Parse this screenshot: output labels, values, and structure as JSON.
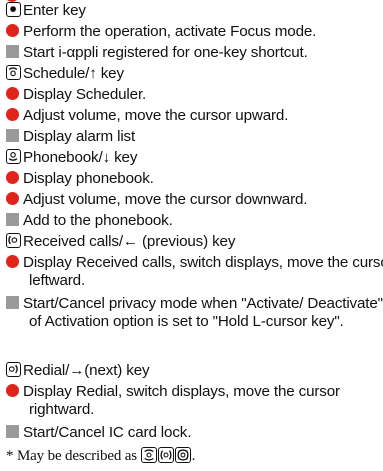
{
  "colors": {
    "bullet": "#e0241b",
    "square": "#9a9a9a"
  },
  "lines": [
    {
      "key_icon": "enter-key-icon",
      "text": "Enter key"
    },
    {
      "text": "Perform the operation, activate Focus mode."
    },
    {
      "text": "Start i-αppli registered for one-key shortcut."
    },
    {
      "key_icon": "schedule-up-key-icon",
      "text": "Schedule/↑ key"
    },
    {
      "text": "Display Scheduler."
    },
    {
      "text": "Adjust volume, move the cursor upward."
    },
    {
      "text": "Display alarm list"
    },
    {
      "key_icon": "phonebook-down-key-icon",
      "text": "Phonebook/↓ key"
    },
    {
      "text": "Display phonebook."
    },
    {
      "text": "Adjust volume, move the cursor downward."
    },
    {
      "text": "Add to the phonebook."
    },
    {
      "key_icon": "received-calls-left-key-icon",
      "text": "Received calls/← (previous) key"
    },
    {
      "text": "Display Received calls, switch displays, move the cursor leftward."
    },
    {
      "text": "Start/Cancel privacy mode when \"Activate/ Deactivate\" of Activation option is set to \"Hold L-cursor key\"."
    },
    {
      "key_icon": "redial-right-key-icon",
      "text": "Redial/→(next) key"
    },
    {
      "text": "Display Redial, switch displays, move the cursor rightward."
    },
    {
      "text": "Start/Cancel IC card lock."
    },
    {
      "text": "* May be described as",
      "trailing": "."
    }
  ]
}
